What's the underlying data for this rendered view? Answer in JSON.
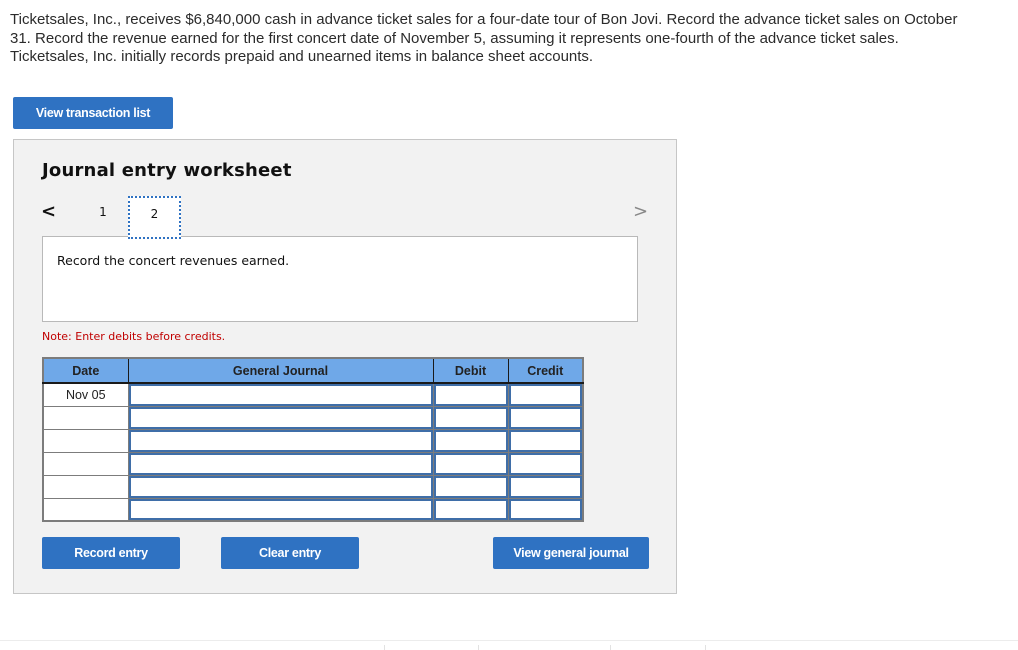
{
  "question": {
    "text": "Ticketsales, Inc., receives $6,840,000 cash in advance ticket sales for a four-date tour of Bon Jovi. Record the advance ticket sales on October 31. Record the revenue earned for the first concert date of November 5, assuming it represents one-fourth of the advance ticket sales. Ticketsales, Inc. initially records prepaid and unearned items in balance sheet accounts."
  },
  "buttons": {
    "view_transaction_list": "View transaction list",
    "record_entry": "Record entry",
    "clear_entry": "Clear entry",
    "view_general_journal": "View general journal"
  },
  "worksheet": {
    "title": "Journal entry worksheet",
    "nav": {
      "prev_icon": "chevron-left-icon",
      "next_icon": "chevron-right-icon",
      "prev_glyph": "<",
      "next_glyph": ">",
      "tabs": [
        {
          "label": "1",
          "active": false
        },
        {
          "label": "2",
          "active": true
        }
      ]
    },
    "instruction": "Record the concert revenues earned.",
    "note": "Note: Enter debits before credits."
  },
  "journal": {
    "columns": [
      "Date",
      "General Journal",
      "Debit",
      "Credit"
    ],
    "rows": [
      {
        "date": "Nov 05",
        "account": "",
        "debit": "",
        "credit": ""
      },
      {
        "date": "",
        "account": "",
        "debit": "",
        "credit": ""
      },
      {
        "date": "",
        "account": "",
        "debit": "",
        "credit": ""
      },
      {
        "date": "",
        "account": "",
        "debit": "",
        "credit": ""
      },
      {
        "date": "",
        "account": "",
        "debit": "",
        "credit": ""
      },
      {
        "date": "",
        "account": "",
        "debit": "",
        "credit": ""
      }
    ]
  },
  "colors": {
    "button_blue": "#2f72c2",
    "header_blue": "#6fa8e8",
    "note_red": "#c00000",
    "panel_gray": "#f2f2f2"
  }
}
